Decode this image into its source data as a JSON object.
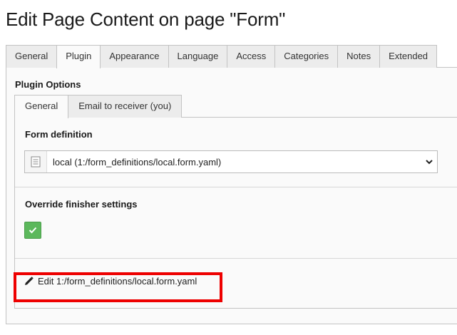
{
  "page": {
    "title": "Edit Page Content on page \"Form\""
  },
  "top_tabs": [
    {
      "label": "General",
      "active": false
    },
    {
      "label": "Plugin",
      "active": true
    },
    {
      "label": "Appearance",
      "active": false
    },
    {
      "label": "Language",
      "active": false
    },
    {
      "label": "Access",
      "active": false
    },
    {
      "label": "Categories",
      "active": false
    },
    {
      "label": "Notes",
      "active": false
    },
    {
      "label": "Extended",
      "active": false
    }
  ],
  "plugin_options": {
    "label": "Plugin Options",
    "inner_tabs": [
      {
        "label": "General",
        "active": true
      },
      {
        "label": "Email to receiver (you)",
        "active": false
      }
    ],
    "form_definition": {
      "label": "Form definition",
      "selected_value": "local (1:/form_definitions/local.form.yaml)"
    },
    "override_finisher": {
      "label": "Override finisher settings",
      "checked": true
    },
    "edit_link": {
      "label": "Edit 1:/form_definitions/local.form.yaml"
    }
  },
  "colors": {
    "checkbox_green": "#5cb85c",
    "highlight_red": "#ee0000"
  },
  "icons": {
    "select_icon": "document-list-icon",
    "caret": "chevron-down-icon",
    "check": "checkmark-icon",
    "edit": "pencil-icon"
  }
}
